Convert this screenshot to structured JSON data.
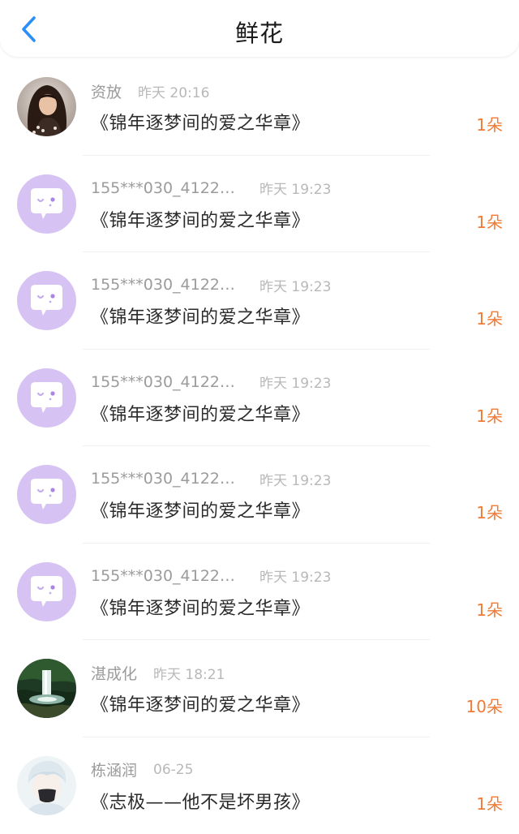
{
  "header": {
    "title": "鲜花"
  },
  "list": [
    {
      "avatar": "portrait-woman",
      "name": "资放",
      "time": "昨天 20:16",
      "book": "《锦年逐梦间的爱之华章》",
      "count": "1朵"
    },
    {
      "avatar": "default-chat-bubble",
      "name": "155***030_41221...",
      "time": "昨天 19:23",
      "book": "《锦年逐梦间的爱之华章》",
      "count": "1朵"
    },
    {
      "avatar": "default-chat-bubble",
      "name": "155***030_41221...",
      "time": "昨天 19:23",
      "book": "《锦年逐梦间的爱之华章》",
      "count": "1朵"
    },
    {
      "avatar": "default-chat-bubble",
      "name": "155***030_41221...",
      "time": "昨天 19:23",
      "book": "《锦年逐梦间的爱之华章》",
      "count": "1朵"
    },
    {
      "avatar": "default-chat-bubble",
      "name": "155***030_41221...",
      "time": "昨天 19:23",
      "book": "《锦年逐梦间的爱之华章》",
      "count": "1朵"
    },
    {
      "avatar": "default-chat-bubble",
      "name": "155***030_41221...",
      "time": "昨天 19:23",
      "book": "《锦年逐梦间的爱之华章》",
      "count": "1朵"
    },
    {
      "avatar": "waterfall-landscape",
      "name": "湛成化",
      "time": "昨天 18:21",
      "book": "《锦年逐梦间的爱之华章》",
      "count": "10朵"
    },
    {
      "avatar": "anime-masked-boy",
      "name": "栋涵润",
      "time": "06-25",
      "book": "《志极——他不是坏男孩》",
      "count": "1朵"
    }
  ],
  "colors": {
    "accent_blue": "#2a8ff7",
    "count_orange": "#f07a36",
    "default_avatar": "#d6c3f4"
  }
}
